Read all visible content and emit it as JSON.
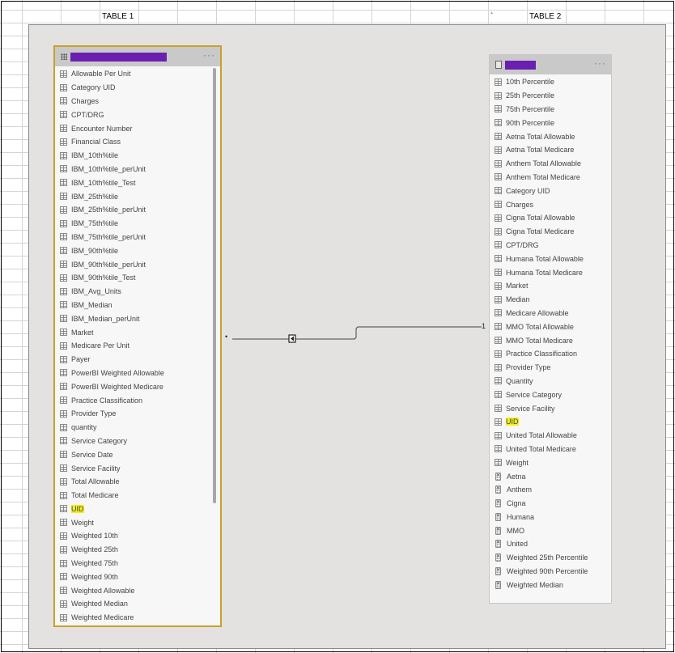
{
  "sheet": {
    "table1_label": "TABLE 1",
    "table2_label": "TABLE 2",
    "tick_mark": "`"
  },
  "table1": {
    "title": "",
    "more_label": "···",
    "fields": [
      {
        "label": "Allowable Per Unit"
      },
      {
        "label": "Category UID"
      },
      {
        "label": "Charges"
      },
      {
        "label": "CPT/DRG"
      },
      {
        "label": "Encounter Number"
      },
      {
        "label": "Financial Class"
      },
      {
        "label": "IBM_10th%tile"
      },
      {
        "label": "IBM_10th%tile_perUnit"
      },
      {
        "label": "IBM_10th%tile_Test"
      },
      {
        "label": "IBM_25th%tile"
      },
      {
        "label": "IBM_25th%tile_perUnit"
      },
      {
        "label": "IBM_75th%tile"
      },
      {
        "label": "IBM_75th%tile_perUnit"
      },
      {
        "label": "IBM_90th%tile"
      },
      {
        "label": "IBM_90th%tile_perUnit"
      },
      {
        "label": "IBM_90th%tile_Test"
      },
      {
        "label": "IBM_Avg_Units"
      },
      {
        "label": "IBM_Median"
      },
      {
        "label": "IBM_Median_perUnit"
      },
      {
        "label": "Market"
      },
      {
        "label": "Medicare Per Unit"
      },
      {
        "label": "Payer"
      },
      {
        "label": "PowerBI Weighted Allowable"
      },
      {
        "label": "PowerBI Weighted Medicare"
      },
      {
        "label": "Practice Classification"
      },
      {
        "label": "Provider Type"
      },
      {
        "label": "quantity"
      },
      {
        "label": "Service Category"
      },
      {
        "label": "Service Date"
      },
      {
        "label": "Service Facility"
      },
      {
        "label": "Total Allowable"
      },
      {
        "label": "Total Medicare"
      },
      {
        "label": "UID",
        "highlight": true
      },
      {
        "label": "Weight"
      },
      {
        "label": "Weighted 10th"
      },
      {
        "label": "Weighted 25th"
      },
      {
        "label": "Weighted 75th"
      },
      {
        "label": "Weighted 90th"
      },
      {
        "label": "Weighted Allowable"
      },
      {
        "label": "Weighted Median"
      },
      {
        "label": "Weighted Medicare"
      }
    ]
  },
  "table2": {
    "title": "",
    "more_label": "···",
    "fields": [
      {
        "label": "10th Percentile",
        "kind": "column"
      },
      {
        "label": "25th Percentile",
        "kind": "column"
      },
      {
        "label": "75th Percentile",
        "kind": "column"
      },
      {
        "label": "90th Percentile",
        "kind": "column"
      },
      {
        "label": "Aetna Total Allowable",
        "kind": "column"
      },
      {
        "label": "Aetna Total Medicare",
        "kind": "column"
      },
      {
        "label": "Anthem Total Allowable",
        "kind": "column"
      },
      {
        "label": "Anthem Total Medicare",
        "kind": "column"
      },
      {
        "label": "Category UID",
        "kind": "column"
      },
      {
        "label": "Charges",
        "kind": "column"
      },
      {
        "label": "Cigna Total Allowable",
        "kind": "column"
      },
      {
        "label": "Cigna Total Medicare",
        "kind": "column"
      },
      {
        "label": "CPT/DRG",
        "kind": "column"
      },
      {
        "label": "Humana Total Allowable",
        "kind": "column"
      },
      {
        "label": "Humana Total Medicare",
        "kind": "column"
      },
      {
        "label": "Market",
        "kind": "column"
      },
      {
        "label": "Median",
        "kind": "column"
      },
      {
        "label": "Medicare Allowable",
        "kind": "column"
      },
      {
        "label": "MMO Total Allowable",
        "kind": "column"
      },
      {
        "label": "MMO Total Medicare",
        "kind": "column"
      },
      {
        "label": "Practice Classification",
        "kind": "column"
      },
      {
        "label": "Provider Type",
        "kind": "column"
      },
      {
        "label": "Quantity",
        "kind": "column"
      },
      {
        "label": "Service Category",
        "kind": "column"
      },
      {
        "label": "Service Facility",
        "kind": "column"
      },
      {
        "label": "UID",
        "kind": "column",
        "highlight": true
      },
      {
        "label": "United Total Allowable",
        "kind": "column"
      },
      {
        "label": "United Total Medicare",
        "kind": "column"
      },
      {
        "label": "Weight",
        "kind": "column"
      },
      {
        "label": "Aetna",
        "kind": "measure"
      },
      {
        "label": "Anthem",
        "kind": "measure"
      },
      {
        "label": "Cigna",
        "kind": "measure"
      },
      {
        "label": "Humana",
        "kind": "measure"
      },
      {
        "label": "MMO",
        "kind": "measure"
      },
      {
        "label": "United",
        "kind": "measure"
      },
      {
        "label": "Weighted 25th Percentile",
        "kind": "measure"
      },
      {
        "label": "Weighted 90th Percentile",
        "kind": "measure"
      },
      {
        "label": "Weighted Median",
        "kind": "measure"
      }
    ]
  },
  "relationship": {
    "many_label": "•",
    "one_label": "1"
  },
  "colors": {
    "selected_border": "#c8a12a",
    "highlight": "#f2ee1c",
    "title_redaction": "#6b1fb1",
    "canvas": "#e3e2e0"
  }
}
